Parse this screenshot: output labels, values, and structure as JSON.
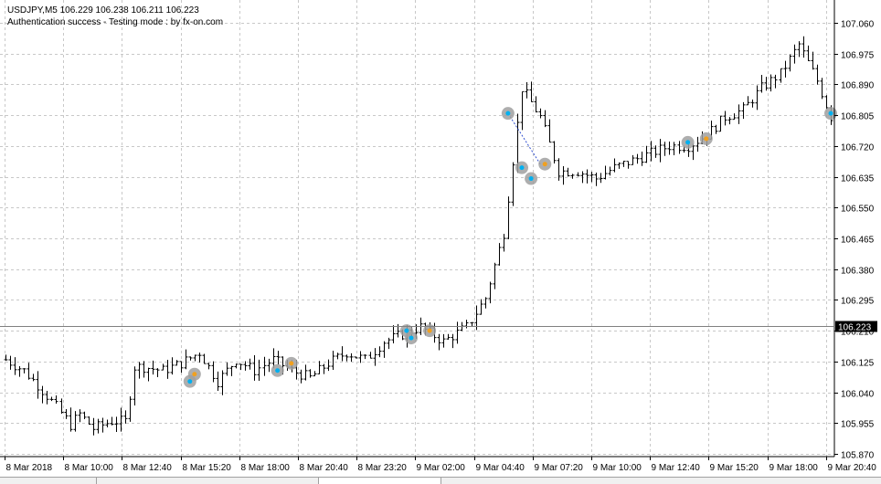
{
  "header": {
    "symbol_line": "USDJPY,M5  106.229 106.238 106.211 106.223",
    "status_line": "Authentication success - Testing mode : by fx-on.com"
  },
  "colors": {
    "background": "#ffffff",
    "grid": "#c8c8c8",
    "bars": "#000000",
    "price_tag_bg": "#000000",
    "price_tag_text": "#ffffff",
    "marker_halo": "#a0a0a0",
    "marker_blue": "#00b0f0",
    "marker_orange": "#f0a020",
    "trade_line": "#3050d0"
  },
  "chart_data": {
    "type": "ohlc",
    "title": "USDJPY,M5",
    "ohlc_label": "106.229 106.238 106.211 106.223",
    "current_price": "106.223",
    "y_ticks": [
      "107.060",
      "106.975",
      "106.890",
      "106.805",
      "106.720",
      "106.635",
      "106.550",
      "106.465",
      "106.380",
      "106.295",
      "106.210",
      "106.125",
      "106.040",
      "105.955",
      "105.870"
    ],
    "x_ticks": [
      "8 Mar 2018",
      "8 Mar 10:00",
      "8 Mar 12:40",
      "8 Mar 15:20",
      "8 Mar 18:00",
      "8 Mar 20:40",
      "8 Mar 23:20",
      "9 Mar 02:00",
      "9 Mar 04:40",
      "9 Mar 07:20",
      "9 Mar 10:00",
      "9 Mar 12:40",
      "9 Mar 15:20",
      "9 Mar 18:00",
      "9 Mar 20:40"
    ],
    "ylim": [
      105.87,
      107.06
    ],
    "grid": true,
    "close_path": [
      [
        0,
        106.13
      ],
      [
        4,
        106.1
      ],
      [
        7,
        106.06
      ],
      [
        11,
        106.0
      ],
      [
        14,
        105.95
      ],
      [
        16,
        105.98
      ],
      [
        19,
        105.94
      ],
      [
        23,
        105.96
      ],
      [
        26,
        105.96
      ],
      [
        28,
        106.11
      ],
      [
        30,
        106.11
      ],
      [
        34,
        106.1
      ],
      [
        38,
        106.12
      ],
      [
        42,
        106.15
      ],
      [
        46,
        106.07
      ],
      [
        50,
        106.13
      ],
      [
        54,
        106.1
      ],
      [
        58,
        106.13
      ],
      [
        62,
        106.1
      ],
      [
        66,
        106.08
      ],
      [
        70,
        106.12
      ],
      [
        74,
        106.15
      ],
      [
        78,
        106.13
      ],
      [
        82,
        106.18
      ],
      [
        86,
        106.2
      ],
      [
        90,
        106.22
      ],
      [
        95,
        106.18
      ],
      [
        100,
        106.22
      ],
      [
        104,
        106.3
      ],
      [
        108,
        106.48
      ],
      [
        112,
        106.88
      ],
      [
        116,
        106.8
      ],
      [
        120,
        106.65
      ],
      [
        124,
        106.65
      ],
      [
        128,
        106.63
      ],
      [
        132,
        106.66
      ],
      [
        136,
        106.68
      ],
      [
        140,
        106.7
      ],
      [
        144,
        106.72
      ],
      [
        148,
        106.72
      ],
      [
        152,
        106.75
      ],
      [
        156,
        106.8
      ],
      [
        160,
        106.82
      ],
      [
        164,
        106.88
      ],
      [
        168,
        106.92
      ],
      [
        172,
        107.0
      ],
      [
        176,
        106.9
      ],
      [
        179,
        106.8
      ]
    ],
    "markers": [
      {
        "x": 40,
        "y": 106.07,
        "color": "blue"
      },
      {
        "x": 41,
        "y": 106.09,
        "color": "orange"
      },
      {
        "x": 59,
        "y": 106.1,
        "color": "blue"
      },
      {
        "x": 62,
        "y": 106.12,
        "color": "orange"
      },
      {
        "x": 87,
        "y": 106.21,
        "color": "blue"
      },
      {
        "x": 88,
        "y": 106.19,
        "color": "blue"
      },
      {
        "x": 92,
        "y": 106.21,
        "color": "orange"
      },
      {
        "x": 109,
        "y": 106.81,
        "color": "blue"
      },
      {
        "x": 112,
        "y": 106.66,
        "color": "blue"
      },
      {
        "x": 114,
        "y": 106.63,
        "color": "blue"
      },
      {
        "x": 117,
        "y": 106.67,
        "color": "orange"
      },
      {
        "x": 148,
        "y": 106.73,
        "color": "blue"
      },
      {
        "x": 152,
        "y": 106.74,
        "color": "orange"
      },
      {
        "x": 179,
        "y": 106.81,
        "color": "blue"
      }
    ],
    "trade_lines": [
      [
        109,
        106.81,
        116,
        106.67
      ]
    ]
  }
}
